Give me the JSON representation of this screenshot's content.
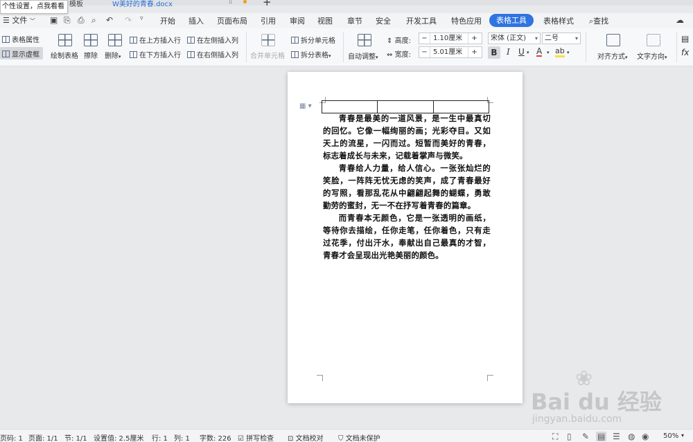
{
  "tabs": {
    "template": "模板",
    "document": "美好的青春.docx",
    "new_tab": "+"
  },
  "tooltip": "个性设置，点我看看",
  "menu": {
    "file": "文件",
    "items": [
      "开始",
      "插入",
      "页面布局",
      "引用",
      "审阅",
      "视图",
      "章节",
      "安全",
      "开发工具",
      "特色应用"
    ],
    "active": "表格工具",
    "after": "表格样式",
    "search": "查找"
  },
  "ribbon": {
    "table_props": "表格属性",
    "show_gridlines": "显示虚框",
    "draw_table": "绘制表格",
    "erase": "擦除",
    "delete": "删除",
    "insert_above": "在上方插入行",
    "insert_below": "在下方插入行",
    "insert_left": "在左侧插入列",
    "insert_right": "在右侧插入列",
    "merge_cells": "合并单元格",
    "split_cells": "拆分单元格",
    "split_table": "拆分表格",
    "auto_fit": "自动调整",
    "height_label": "高度:",
    "height_value": "1.10厘米",
    "width_label": "宽度:",
    "width_value": "5.01厘米",
    "font_name": "宋体 (正文)",
    "font_size": "二号",
    "align": "对齐方式",
    "text_dir": "文字方向"
  },
  "document": {
    "paragraphs": [
      "青春是最美的一道风景，是一生中最真切的回忆。它像一幅绚丽的画；光彩夺目。又如天上的流星，一闪而过。短暂而美好的青春，标志着成长与未来，记载着掌声与微笑。",
      "青春给人力量，给人信心。一张张灿烂的笑脸，一阵阵无忧无虑的笑声，成了青春最好的写照，看那乱花从中翩翩起舞的蝴蝶，勇敢勤劳的蜜封，无一不在抒写着青春的篇章。",
      "而青春本无颜色，它是一张透明的画纸，等待你去描绘，任你走笔，任你着色，只有走过花季，付出汗水，奉献出自己最真的才智，青春才会呈现出光艳美丽的颜色。"
    ]
  },
  "status": {
    "page_code": "页码: 1",
    "pages": "页面: 1/1",
    "section": "节: 1/1",
    "setting": "设置值: 2.5厘米",
    "row": "行: 1",
    "col": "列: 1",
    "word_count": "字数: 226",
    "spell": "拼写检查",
    "proofread": "文档校对",
    "protect": "文档未保护",
    "zoom": "50%"
  },
  "watermark": {
    "brand": "Bai du 经验",
    "url": "jingyan.baidu.com"
  },
  "colors": {
    "accent": "#2f74e0",
    "tab_text": "#2a6fd6",
    "unsaved_dot": "#f39c12"
  }
}
